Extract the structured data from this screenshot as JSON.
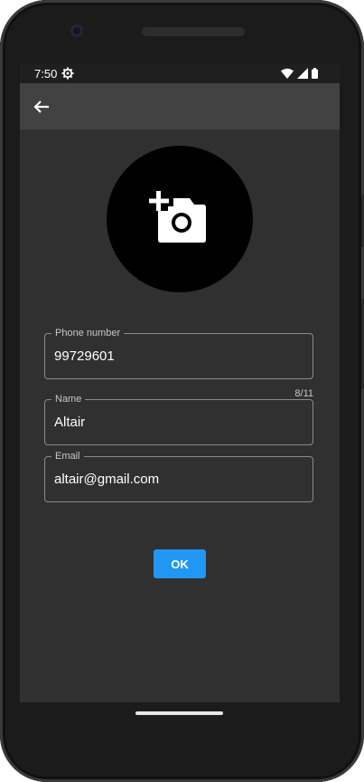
{
  "status_bar": {
    "time": "7:50",
    "icons": [
      "settings-gear-icon",
      "wifi-icon",
      "signal-icon",
      "battery-icon"
    ]
  },
  "app_bar": {
    "back_icon": "arrow-back-icon"
  },
  "avatar": {
    "icon": "add-photo-camera-icon"
  },
  "form": {
    "phone": {
      "label": "Phone number",
      "value": "99729601"
    },
    "name": {
      "label": "Name",
      "value": "Altair",
      "counter": "8/11"
    },
    "email": {
      "label": "Email",
      "value": "altair@gmail.com"
    }
  },
  "actions": {
    "ok_label": "OK"
  },
  "colors": {
    "background": "#303030",
    "app_bar": "#424242",
    "status_bar": "#1f1f1f",
    "accent": "#2196f3",
    "field_border": "#8a8a8a"
  }
}
